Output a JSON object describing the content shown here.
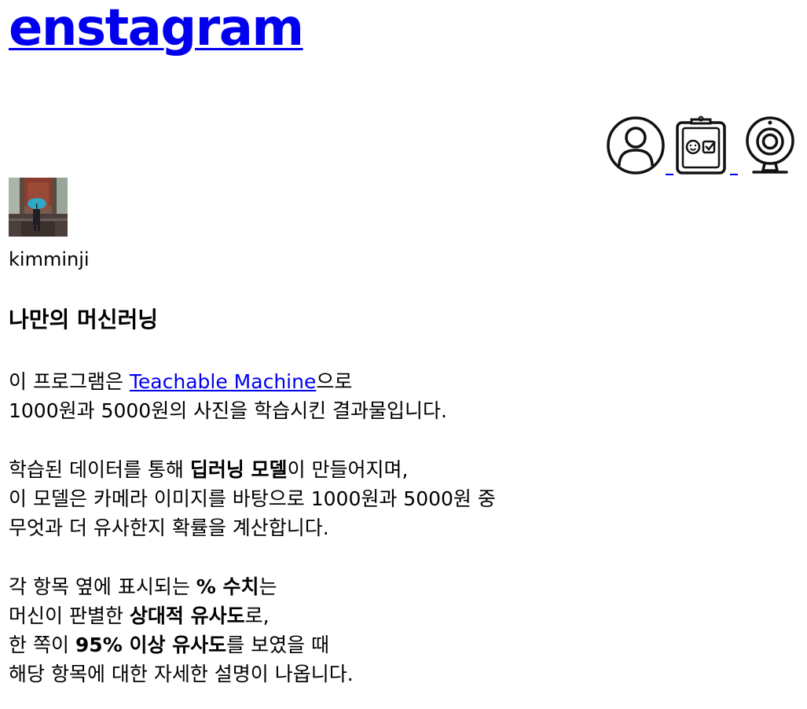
{
  "header": {
    "logo_text": "enstagram"
  },
  "nav": [
    {
      "name": "profile",
      "icon": "user-circle-icon"
    },
    {
      "name": "quiz",
      "icon": "clipboard-face-check-icon"
    },
    {
      "name": "camera",
      "icon": "webcam-icon"
    }
  ],
  "profile": {
    "username": "kimminji",
    "avatar_icon": "umbrella-photo-thumbnail"
  },
  "content": {
    "title": "나만의 머신러닝",
    "p1": {
      "part1": "이 프로그램은 ",
      "link": "Teachable Machine",
      "part2": "으로",
      "line2": "1000원과 5000원의 사진을 학습시킨 결과물입니다."
    },
    "p2": {
      "part1": "학습된 데이터를 통해 ",
      "bold1": "딥러닝 모델",
      "part2": "이 만들어지며,",
      "line2": "이 모델은 카메라 이미지를 바탕으로 1000원과 5000원 중",
      "line3": "무엇과 더 유사한지 확률을 계산합니다."
    },
    "p3": {
      "part1": "각 항목 옆에 표시되는 ",
      "bold1": "% 수치",
      "part2": "는",
      "part3": "머신이 판별한 ",
      "bold2": "상대적 유사도",
      "part4": "로,",
      "part5": "한 쪽이 ",
      "bold3": "95% 이상 유사도",
      "part6": "를 보였을 때",
      "line4": "해당 항목에 대한 자세한 설명이 나옵니다."
    }
  }
}
